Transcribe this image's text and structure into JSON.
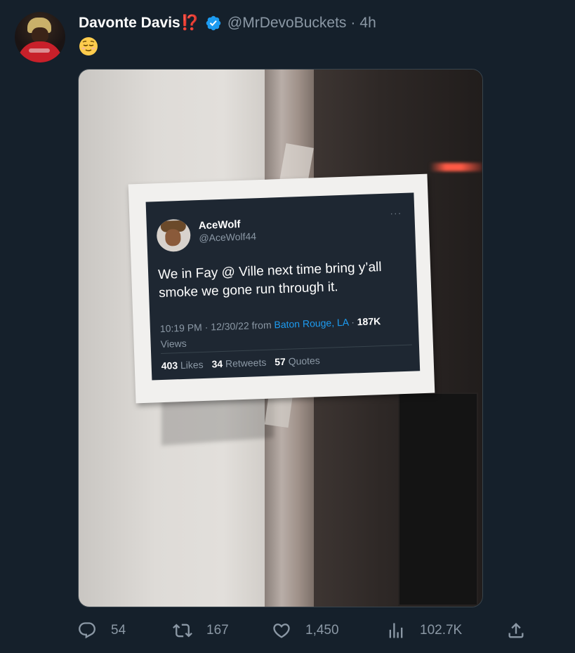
{
  "tweet": {
    "author_name": "Davonte Davis",
    "author_badge": "⁉️",
    "handle": "@MrDevoBuckets",
    "separator": "·",
    "time": "4h",
    "emoji_icon": "relieved-face-icon",
    "colors": {
      "accent": "#1d9bf0",
      "background": "#15202b",
      "muted": "#8b98a5",
      "badge": "#e8323c"
    }
  },
  "embedded_screenshot": {
    "name": "AceWolf",
    "handle": "@AceWolf44",
    "text": "We in Fay @ Ville next time bring y’all smoke we gone run through it.",
    "time": "10:19 PM",
    "date": "12/30/22",
    "from_label": "from",
    "location": "Baton Rouge, LA",
    "views_count": "187K",
    "views_label": "Views",
    "likes_count": "403",
    "likes_label": "Likes",
    "retweets_count": "34",
    "retweets_label": "Retweets",
    "quotes_count": "57",
    "quotes_label": "Quotes",
    "more_glyph": "···"
  },
  "actions": {
    "replies": "54",
    "retweets": "167",
    "likes": "1,450",
    "views": "102.7K"
  }
}
